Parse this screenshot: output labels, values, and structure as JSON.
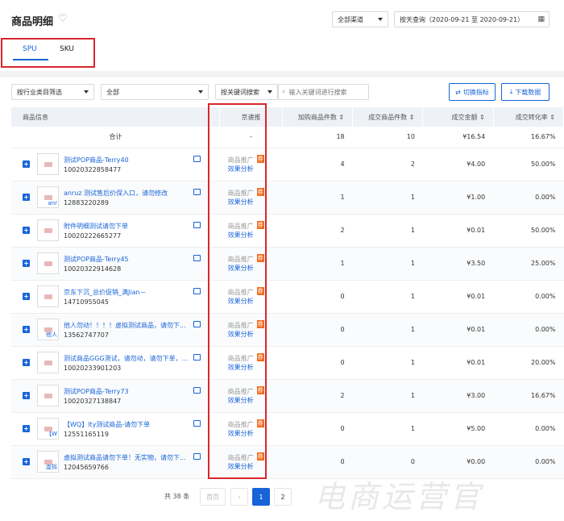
{
  "header": {
    "title": "商品明细",
    "channel_select": "全部渠道",
    "date_query": "按天查询（2020-09-21 至 2020-09-21）"
  },
  "tabs": [
    {
      "label": "SPU",
      "active": true
    },
    {
      "label": "SKU",
      "active": false
    }
  ],
  "filters": {
    "category_select": "按行业类目筛选",
    "all_select": "全部",
    "keyword_mode": "按关键词搜索",
    "search_placeholder": "输入关键词进行搜索",
    "switch_metrics": "切换指标",
    "download": "下载数据"
  },
  "table": {
    "columns": [
      "商品信息",
      "京速推",
      "加购商品件数",
      "成交商品件数",
      "成交金额",
      "成交转化率"
    ],
    "total": {
      "label": "合计",
      "jst": "-",
      "cart": "18",
      "sold": "10",
      "amount": "¥16.54",
      "rate": "16.67%"
    },
    "promo_label": "商品推广",
    "effect_label": "效果分析",
    "coupon_badge": "券",
    "rows": [
      {
        "name": "测试POP商品-Terry40",
        "id": "10020322858477",
        "thumb": "",
        "cart": "4",
        "sold": "2",
        "amount": "¥4.00",
        "rate": "50.00%"
      },
      {
        "name": "anruz 测试售后价保入口，请勿修改",
        "id": "12883220289",
        "thumb": "anr",
        "cart": "1",
        "sold": "1",
        "amount": "¥1.00",
        "rate": "0.00%"
      },
      {
        "name": "附件明细测试请勿下单",
        "id": "10020222665277",
        "thumb": "",
        "cart": "2",
        "sold": "1",
        "amount": "¥0.01",
        "rate": "50.00%"
      },
      {
        "name": "测试POP商品-Terry45",
        "id": "10020322914628",
        "thumb": "",
        "cart": "1",
        "sold": "1",
        "amount": "¥3.50",
        "rate": "25.00%"
      },
      {
        "name": "京东下沉_总价促销_满Jian－",
        "id": "14710955045",
        "thumb": "",
        "cart": "0",
        "sold": "1",
        "amount": "¥0.01",
        "rate": "0.00%"
      },
      {
        "name": "他人勿动！！！！虚拟测试商品，请勿下...",
        "id": "13562747707",
        "thumb": "他人",
        "cart": "0",
        "sold": "1",
        "amount": "¥0.01",
        "rate": "0.00%"
      },
      {
        "name": "测试商品GGG测试，请勿动，请勿下单，...",
        "id": "10020233901203",
        "thumb": "",
        "cart": "0",
        "sold": "1",
        "amount": "¥0.01",
        "rate": "20.00%"
      },
      {
        "name": "测试POP商品-Terry73",
        "id": "10020327138847",
        "thumb": "",
        "cart": "2",
        "sold": "1",
        "amount": "¥3.00",
        "rate": "16.67%"
      },
      {
        "name": "【WQ】lty测试商品-请勿下单",
        "id": "12551165119",
        "thumb": "【W",
        "cart": "0",
        "sold": "1",
        "amount": "¥5.00",
        "rate": "0.00%"
      },
      {
        "name": "虚拟测试商品请勿下单！无实物，请勿下...",
        "id": "12045659766",
        "thumb": "虚拟",
        "cart": "0",
        "sold": "0",
        "amount": "¥0.00",
        "rate": "0.00%"
      }
    ]
  },
  "pagination": {
    "total_text": "共 38 条",
    "first_page": "首页",
    "prev": "‹",
    "pages": [
      "1",
      "2"
    ],
    "current": "1"
  },
  "watermark": "电商运营官",
  "colors": {
    "accent": "#1764d8",
    "highlight_box": "#d9262c",
    "coupon": "#f06c1e"
  }
}
